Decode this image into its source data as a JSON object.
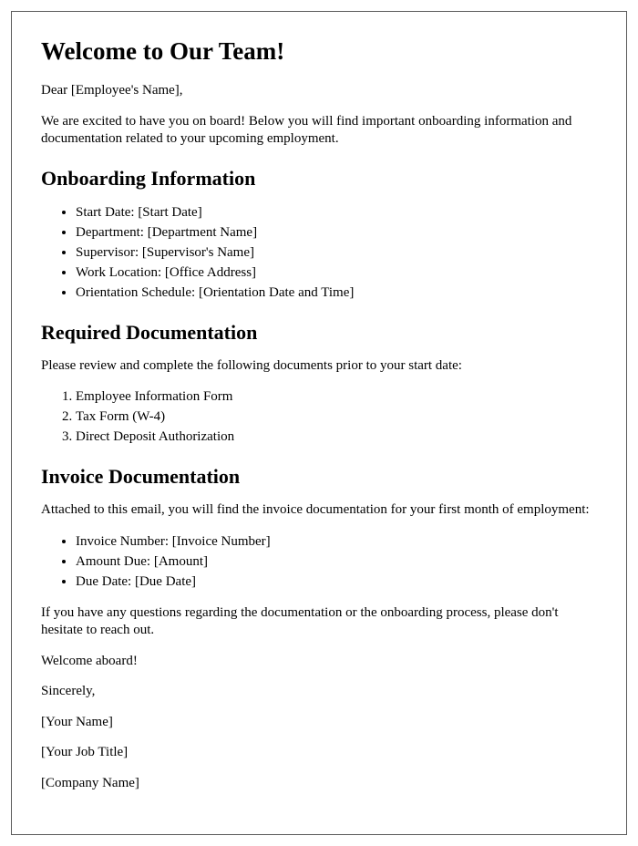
{
  "title": "Welcome to Our Team!",
  "greeting": "Dear [Employee's Name],",
  "intro": "We are excited to have you on board! Below you will find important onboarding information and documentation related to your upcoming employment.",
  "section_onboarding": {
    "heading": "Onboarding Information",
    "items": [
      "Start Date: [Start Date]",
      "Department: [Department Name]",
      "Supervisor: [Supervisor's Name]",
      "Work Location: [Office Address]",
      "Orientation Schedule: [Orientation Date and Time]"
    ]
  },
  "section_required": {
    "heading": "Required Documentation",
    "lead": "Please review and complete the following documents prior to your start date:",
    "items": [
      "Employee Information Form",
      "Tax Form (W-4)",
      "Direct Deposit Authorization"
    ]
  },
  "section_invoice": {
    "heading": "Invoice Documentation",
    "lead": "Attached to this email, you will find the invoice documentation for your first month of employment:",
    "items": [
      "Invoice Number: [Invoice Number]",
      "Amount Due: [Amount]",
      "Due Date: [Due Date]"
    ]
  },
  "closing_note": "If you have any questions regarding the documentation or the onboarding process, please don't hesitate to reach out.",
  "welcome_line": "Welcome aboard!",
  "signoff": "Sincerely,",
  "sender_name": "[Your Name]",
  "sender_title": "[Your Job Title]",
  "sender_company": "[Company Name]"
}
